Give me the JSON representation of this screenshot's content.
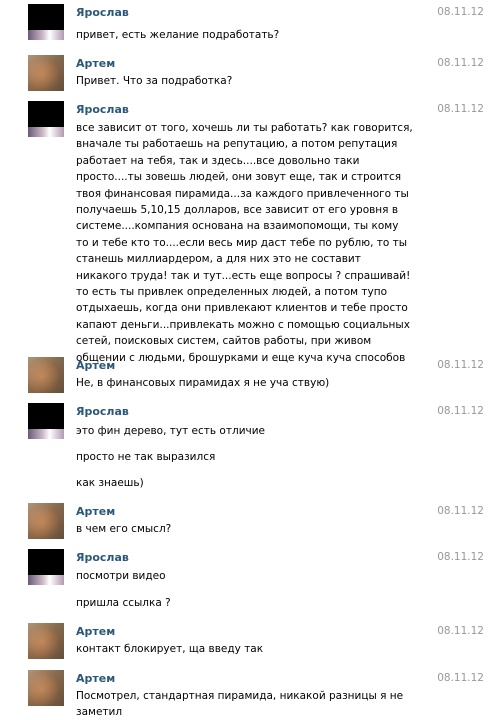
{
  "messages": [
    {
      "author": "Ярослав",
      "date": "08.11.12",
      "avatar": "blocked",
      "lines": [
        "привет, есть желание подработать?"
      ]
    },
    {
      "author": "Артем",
      "date": "08.11.12",
      "avatar": "cat",
      "lines": [
        "Привет. Что за подработка?"
      ]
    },
    {
      "author": "Ярослав",
      "date": "08.11.12",
      "avatar": "blocked",
      "lines": [
        "все зависит от того, хочешь ли ты работать? как говорится, вначале ты работаешь на репутацию, а потом репутация работает на тебя, так и здесь....все довольно таки просто....ты зовешь людей, они зовут еще, так и строится твоя финансовая пирамида...за каждого привлеченного ты получаешь 5,10,15 долларов, все зависит от его уровня в системе....компания основана на взаимопомощи, ты кому то и тебе кто то....если весь мир даст тебе по рублю, то ты станешь миллиардером, а для них это не составит никакого труда! так и тут...есть еще вопросы ? спрашивай!то есть ты привлек определенных людей, а потом тупо отдыхаешь, когда они привлекают клиентов и тебе просто капают деньги...привлекать можно с помощью социальных сетей, поисковых систем, сайтов работы, при живом общении с людьми, брошурками и еще куча куча способов"
      ]
    },
    {
      "author": "Артем",
      "date": "08.11.12",
      "avatar": "cat",
      "lines": [
        "Не, в финансовых пирамидах я не уча ствую)"
      ]
    },
    {
      "author": "Ярослав",
      "date": "08.11.12",
      "avatar": "blocked",
      "lines": [
        "это фин дерево, тут есть отличие",
        "просто не так выразился",
        "как знаешь)"
      ]
    },
    {
      "author": "Артем",
      "date": "08.11.12",
      "avatar": "cat",
      "lines": [
        "в чем его смысл?"
      ]
    },
    {
      "author": "Ярослав",
      "date": "08.11.12",
      "avatar": "blocked",
      "lines": [
        "посмотри видео",
        "пришла ссылка ?"
      ]
    },
    {
      "author": "Артем",
      "date": "08.11.12",
      "avatar": "cat",
      "lines": [
        "контакт блокирует, ща введу так"
      ]
    },
    {
      "author": "Артем",
      "date": "08.11.12",
      "avatar": "cat",
      "lines": [
        "Посмотрел, стандартная пирамида, никакой разницы я не заметил"
      ]
    }
  ]
}
